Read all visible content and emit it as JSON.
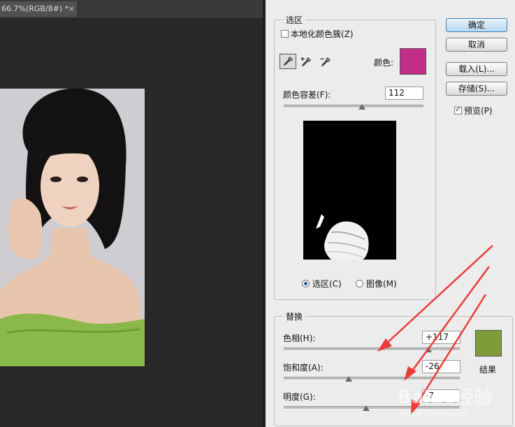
{
  "document_tab": {
    "title": "66.7%(RGB/8#) *",
    "close": "×"
  },
  "dialog": {
    "selection_group": {
      "title": "选区",
      "localized_clusters_label": "本地化颜色簇(Z)",
      "localized_clusters_checked": false,
      "color_label": "颜色:",
      "selection_color": "#c12d87",
      "fuzziness_label": "颜色容差(F):",
      "fuzziness_value": "112",
      "fuzziness_fraction": 0.56,
      "view_selection_label": "选区(C)",
      "view_image_label": "图像(M)",
      "view_mode": "selection"
    },
    "buttons": {
      "ok": "确定",
      "cancel": "取消",
      "load": "载入(L)...",
      "save": "存储(S)..."
    },
    "preview_label": "预览(P)",
    "preview_checked": true,
    "replace_group": {
      "title": "替换",
      "hue_label": "色相(H):",
      "hue_value": "+117",
      "hue_fraction": 0.82,
      "saturation_label": "饱和度(A):",
      "saturation_value": "-26",
      "saturation_fraction": 0.37,
      "lightness_label": "明度(G):",
      "lightness_value": "-7",
      "lightness_fraction": 0.47,
      "result_label": "结果",
      "result_color": "#7f9c3a"
    }
  },
  "watermark": {
    "brand": "Baidu经验",
    "url": "jingyan.baidu.com"
  }
}
